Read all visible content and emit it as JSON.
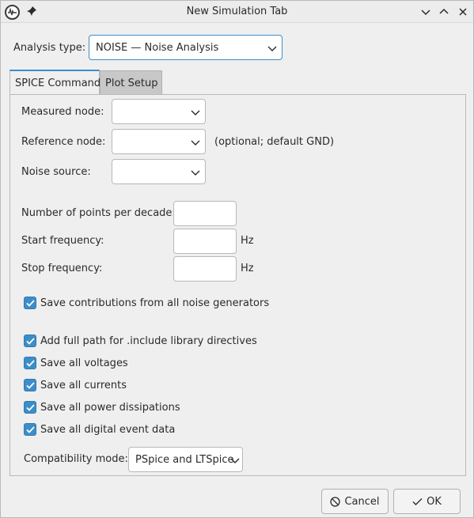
{
  "window": {
    "title": "New Simulation Tab",
    "icons": [
      "kicad-app-icon",
      "pin-icon",
      "minimize-icon",
      "maximize-icon",
      "close-icon"
    ]
  },
  "analysis": {
    "label": "Analysis type:",
    "selected": "NOISE  —  Noise Analysis"
  },
  "tabs": [
    {
      "label": "SPICE Command",
      "active": true
    },
    {
      "label": "Plot Setup",
      "active": false
    }
  ],
  "nodes": {
    "measured_label": "Measured node:",
    "measured_value": "",
    "reference_label": "Reference node:",
    "reference_value": "",
    "reference_hint": "(optional; default GND)",
    "source_label": "Noise source:",
    "source_value": ""
  },
  "frequency": {
    "points_label": "Number of points per decade:",
    "points_value": "",
    "start_label": "Start frequency:",
    "start_value": "",
    "start_unit": "Hz",
    "stop_label": "Stop frequency:",
    "stop_value": "",
    "stop_unit": "Hz"
  },
  "options": {
    "contributions": {
      "label": "Save contributions from all noise generators",
      "checked": true
    },
    "full_path": {
      "label": "Add full path for .include library directives",
      "checked": true
    },
    "voltages": {
      "label": "Save all voltages",
      "checked": true
    },
    "currents": {
      "label": "Save all currents",
      "checked": true
    },
    "power": {
      "label": "Save all power dissipations",
      "checked": true
    },
    "digital": {
      "label": "Save all digital event data",
      "checked": true
    }
  },
  "compatibility": {
    "label": "Compatibility mode:",
    "selected": "PSpice and LTSpice"
  },
  "buttons": {
    "cancel": "Cancel",
    "ok": "OK"
  },
  "colors": {
    "accent": "#3c8ec9",
    "background": "#efefef",
    "inactive_tab": "#c8c8c8"
  }
}
